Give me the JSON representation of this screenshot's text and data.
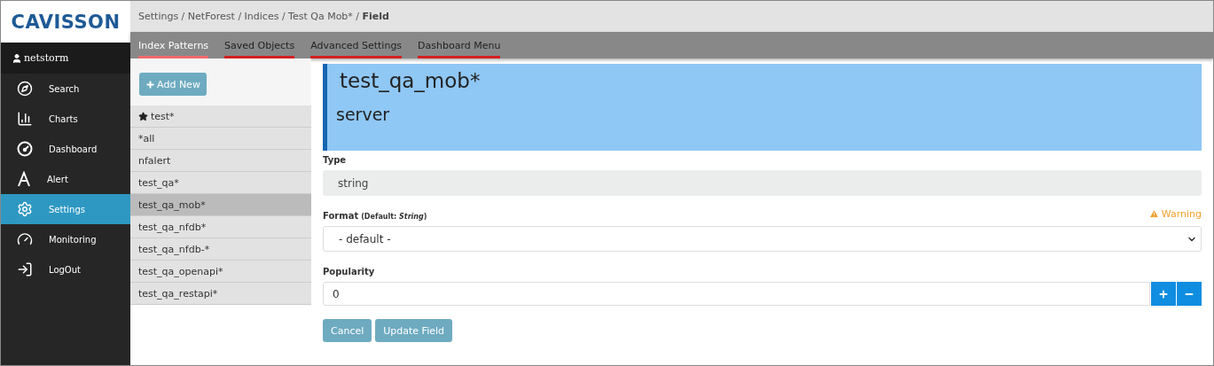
{
  "logo": "CAVISSON",
  "user": "netstorm",
  "nav": [
    {
      "label": "Search",
      "selected": false
    },
    {
      "label": "Charts",
      "selected": false
    },
    {
      "label": "Dashboard",
      "selected": false
    },
    {
      "label": "Alert",
      "selected": false
    },
    {
      "label": "Settings",
      "selected": true
    },
    {
      "label": "Monitoring",
      "selected": false
    },
    {
      "label": "LogOut",
      "selected": false
    }
  ],
  "breadcrumb": "Settings / NetForest / Indices / Test Qa Mob* / **Field**",
  "tabs": [
    {
      "label": "Index Patterns",
      "selected": true
    },
    {
      "label": "Saved Objects",
      "selected": false
    },
    {
      "label": "Advanced Settings",
      "selected": false
    },
    {
      "label": "Dashboard Menu",
      "selected": false
    }
  ],
  "add_button": "Add New",
  "patterns": [
    {
      "label": "test*",
      "default": true,
      "selected": false
    },
    {
      "label": "*all",
      "default": false,
      "selected": false
    },
    {
      "label": "nfalert",
      "default": false,
      "selected": false
    },
    {
      "label": "test_qa*",
      "default": false,
      "selected": false
    },
    {
      "label": "test_qa_mob*",
      "default": false,
      "selected": true
    },
    {
      "label": "test_qa_nfdb*",
      "default": false,
      "selected": false
    },
    {
      "label": "test_qa_nfdb-*",
      "default": false,
      "selected": false
    },
    {
      "label": "test_qa_openapi*",
      "default": false,
      "selected": false
    },
    {
      "label": "test_qa_restapi*",
      "default": false,
      "selected": false
    }
  ],
  "header": {
    "title": "test_qa_mob*",
    "subtitle": "server"
  },
  "type": {
    "label": "Type",
    "value": "string"
  },
  "format": {
    "label": "Format",
    "hint": "(Default: *String*)",
    "warning": "Warning",
    "value": "- default -"
  },
  "popularity": {
    "label": "Popularity",
    "value": "0"
  },
  "buttons": [
    "Cancel",
    "Update Field"
  ]
}
